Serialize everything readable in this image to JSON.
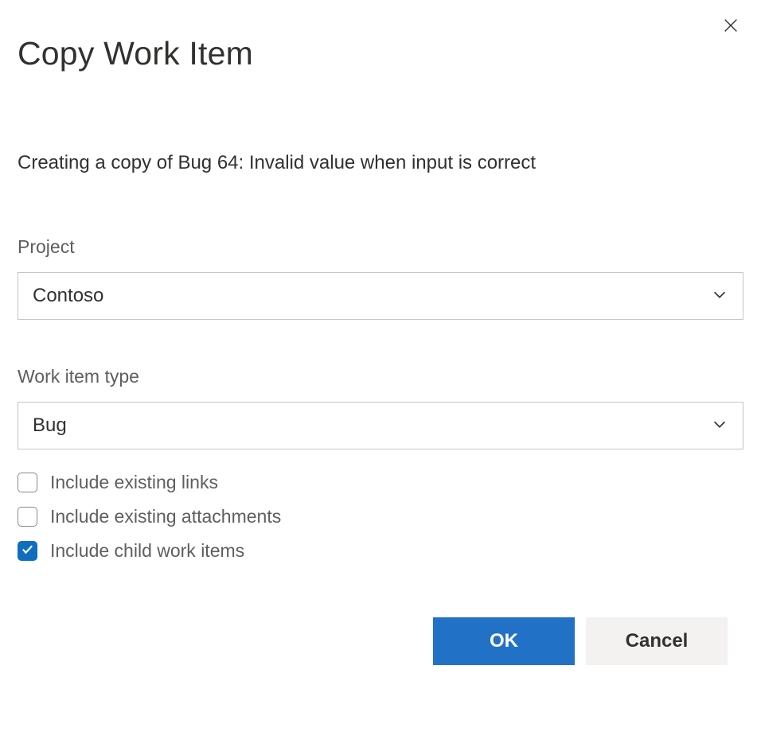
{
  "dialog": {
    "title": "Copy Work Item",
    "description": "Creating a copy of Bug 64: Invalid value when input is correct"
  },
  "fields": {
    "project": {
      "label": "Project",
      "value": "Contoso"
    },
    "workItemType": {
      "label": "Work item type",
      "value": "Bug"
    }
  },
  "checkboxes": {
    "includeLinks": {
      "label": "Include existing links",
      "checked": false
    },
    "includeAttachments": {
      "label": "Include existing attachments",
      "checked": false
    },
    "includeChildren": {
      "label": "Include child work items",
      "checked": true
    }
  },
  "buttons": {
    "ok": "OK",
    "cancel": "Cancel"
  }
}
